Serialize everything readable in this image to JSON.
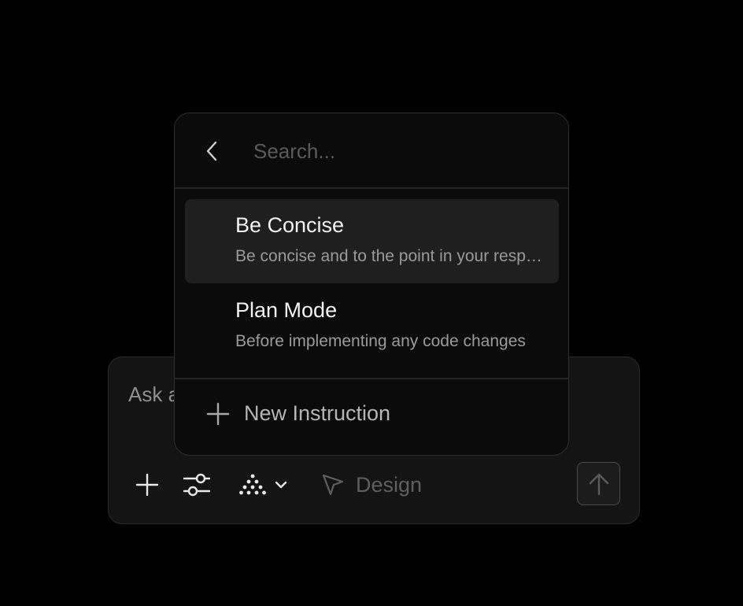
{
  "composer": {
    "input_placeholder": "Ask a",
    "design_label": "Design"
  },
  "popover": {
    "search_placeholder": "Search...",
    "items": [
      {
        "title": "Be Concise",
        "description": "Be concise and to the point in your responses"
      },
      {
        "title": "Plan Mode",
        "description": "Before implementing any code changes"
      }
    ],
    "new_instruction_label": "New Instruction"
  },
  "icons": {
    "back": "chevron-left-icon",
    "add": "plus-icon",
    "settings": "sliders-icon",
    "model": "triangle-dots-icon",
    "dropdown": "chevron-down-icon",
    "design": "cursor-arrow-icon",
    "send": "arrow-up-icon"
  },
  "colors": {
    "background": "#000000",
    "panel": "#0b0b0b",
    "highlight": "#1f1f1f"
  }
}
